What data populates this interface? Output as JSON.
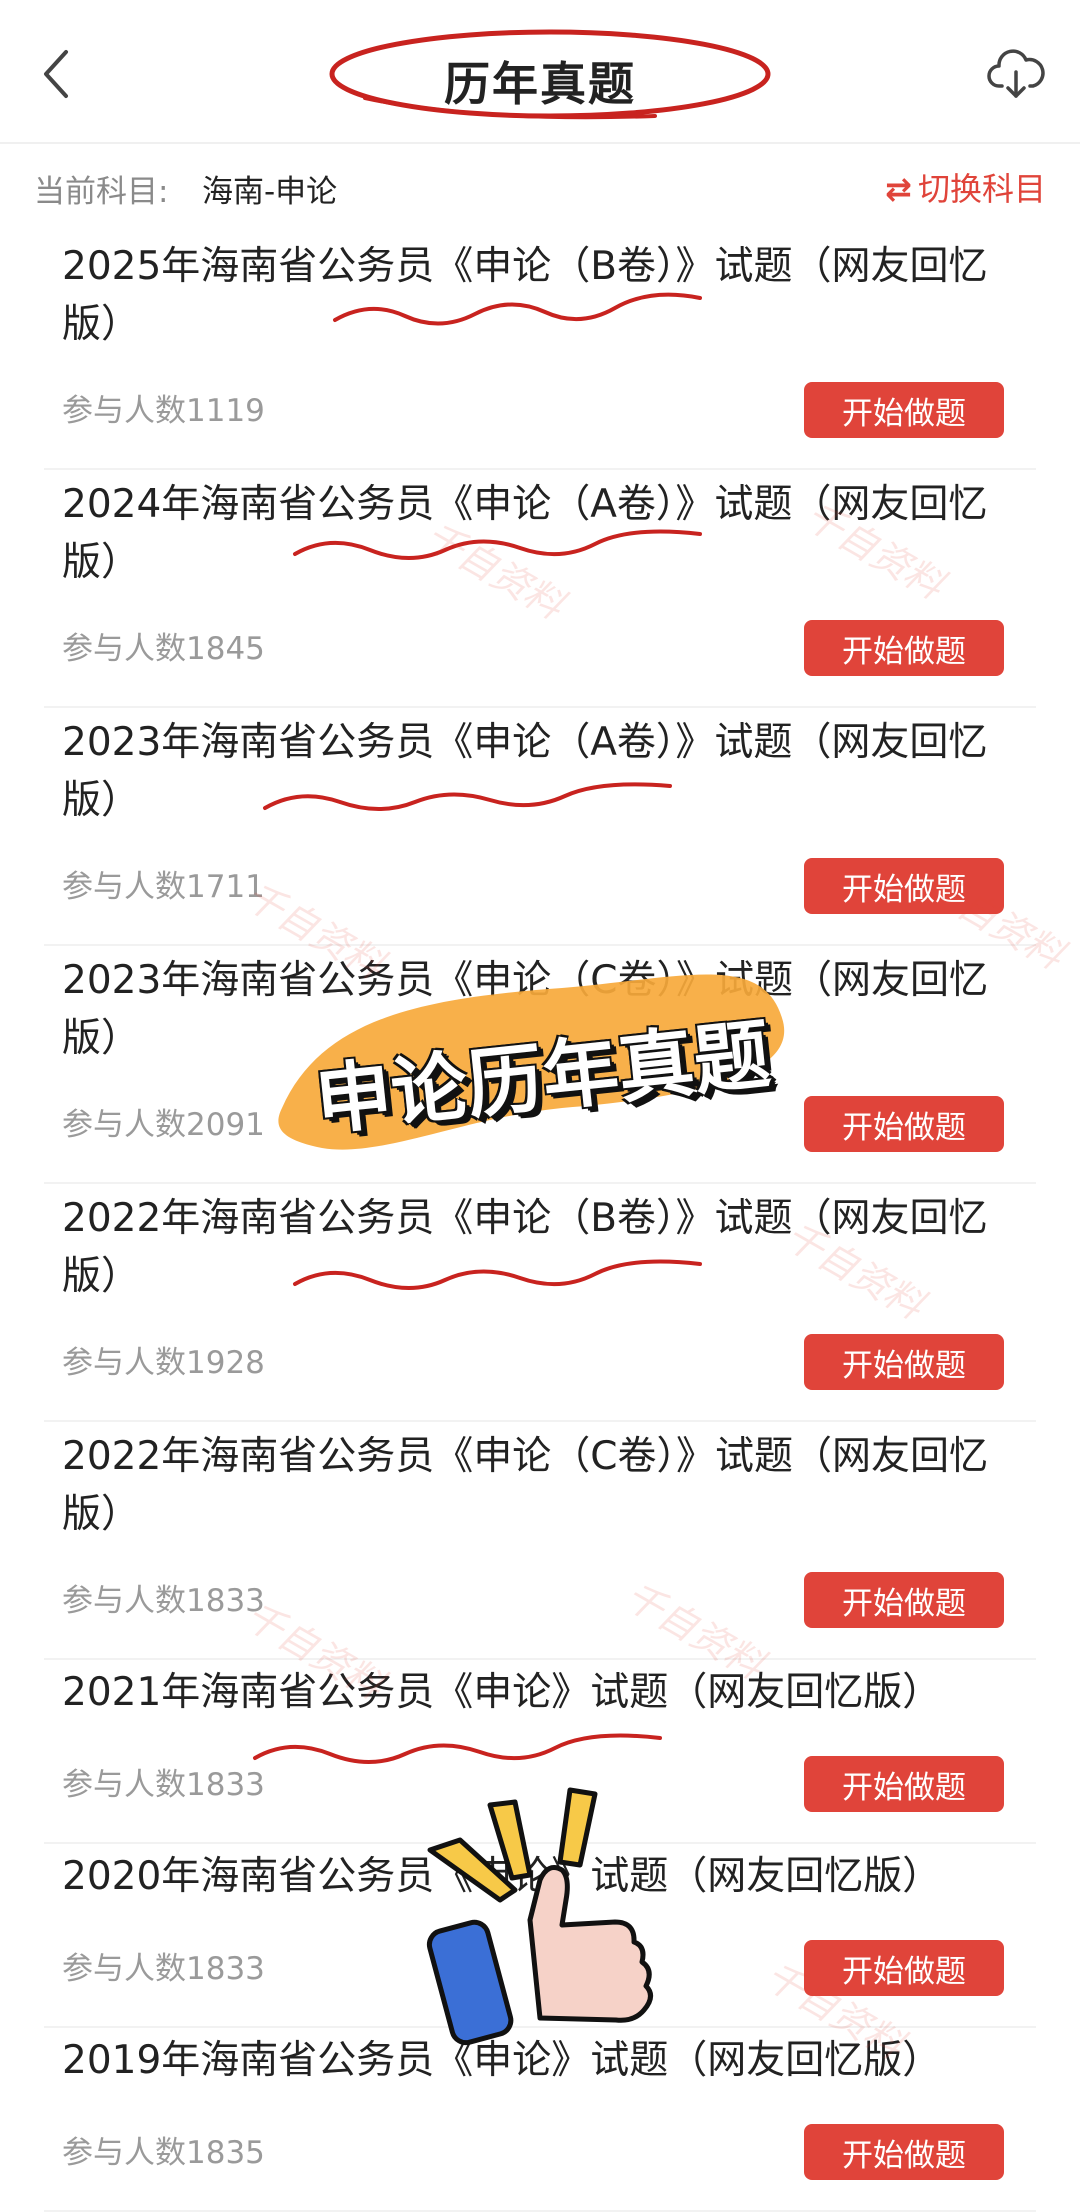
{
  "header": {
    "title": "历年真题",
    "back_icon": "chevron-left-icon",
    "download_icon": "cloud-download-icon"
  },
  "subject": {
    "label": "当前科目:",
    "value": "海南-申论",
    "switch_label": "切换科目",
    "switch_icon": "swap-icon"
  },
  "items": [
    {
      "title": "2025年海南省公务员《申论（B卷）》试题（网友回忆版）",
      "count": "参与人数1119",
      "button": "开始做题"
    },
    {
      "title": "2024年海南省公务员《申论（A卷）》试题（网友回忆版）",
      "count": "参与人数1845",
      "button": "开始做题"
    },
    {
      "title": "2023年海南省公务员《申论（A卷）》试题（网友回忆版）",
      "count": "参与人数1711",
      "button": "开始做题"
    },
    {
      "title": "2023年海南省公务员《申论（C卷）》试题（网友回忆版）",
      "count": "参与人数2091",
      "button": "开始做题"
    },
    {
      "title": "2022年海南省公务员《申论（B卷）》试题（网友回忆版）",
      "count": "参与人数1928",
      "button": "开始做题"
    },
    {
      "title": "2022年海南省公务员《申论（C卷）》试题（网友回忆版）",
      "count": "参与人数1833",
      "button": "开始做题"
    },
    {
      "title": "2021年海南省公务员《申论》试题（网友回忆版）",
      "count": "参与人数1833",
      "button": "开始做题"
    },
    {
      "title": "2020年海南省公务员《申论》试题（网友回忆版）",
      "count": "参与人数1833",
      "button": "开始做题"
    },
    {
      "title": "2019年海南省公务员《申论》试题（网友回忆版）",
      "count": "参与人数1835",
      "button": "开始做题"
    }
  ],
  "overlay": {
    "sticker_text": "申论历年真题",
    "watermark_text": "千自资料"
  },
  "colors": {
    "accent": "#e0443a",
    "sticker_orange": "#f7a93b",
    "annotation_red": "#c8231f"
  }
}
